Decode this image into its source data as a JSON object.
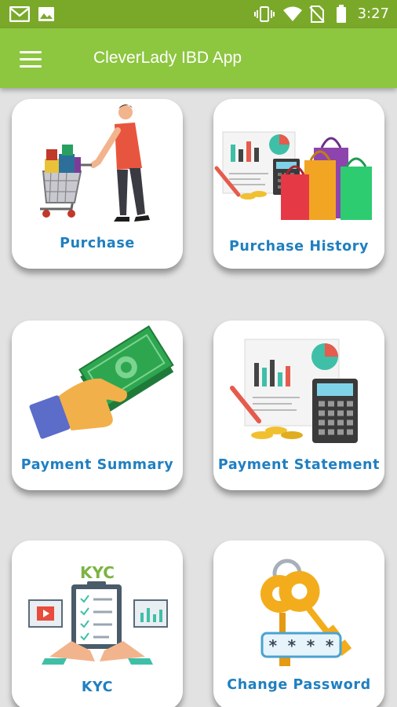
{
  "status_bar": {
    "time": "3:27",
    "left_icons": [
      "gmail-icon",
      "gallery-icon"
    ],
    "right_icons": [
      "vibrate-icon",
      "wifi-icon",
      "no-sim-icon",
      "battery-icon"
    ]
  },
  "app_bar": {
    "title": "CleverLady IBD App",
    "menu_icon": "hamburger-menu-icon"
  },
  "colors": {
    "status_bar": "#7aa92a",
    "app_bar": "#8dc63f",
    "background": "#e2e2e2",
    "card": "#ffffff",
    "label": "#1f7fc0"
  },
  "menu": {
    "items": [
      {
        "label": "Purchase",
        "icon": "shopping-cart-icon"
      },
      {
        "label": "Purchase History",
        "icon": "shopping-bags-report-icon"
      },
      {
        "label": "Payment Summary",
        "icon": "cash-in-hand-icon"
      },
      {
        "label": "Payment Statement",
        "icon": "calculator-report-icon"
      },
      {
        "label": "KYC",
        "icon": "kyc-checklist-icon",
        "art_text": "KYC"
      },
      {
        "label": "Change Password",
        "icon": "keys-password-icon",
        "art_text": "* * * *"
      }
    ]
  }
}
